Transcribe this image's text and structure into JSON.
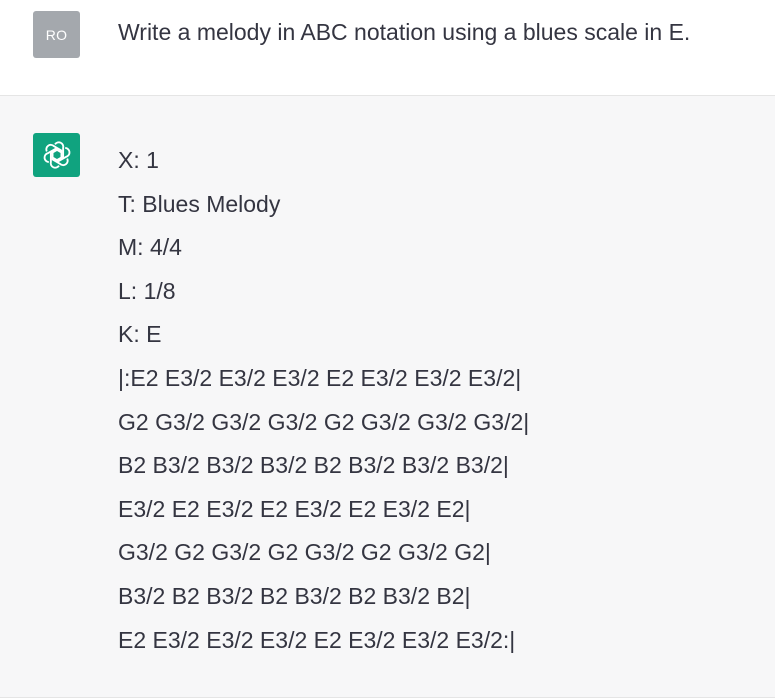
{
  "user_message": {
    "avatar_initials": "RO",
    "text": "Write a melody in ABC notation using a blues scale in E."
  },
  "assistant_message": {
    "avatar_icon": "openai-logo-icon",
    "lines": [
      "X: 1",
      "T: Blues Melody",
      "M: 4/4",
      "L: 1/8",
      "K: E",
      "|:E2 E3/2 E3/2 E3/2 E2 E3/2 E3/2 E3/2|",
      "G2 G3/2 G3/2 G3/2 G2 G3/2 G3/2 G3/2|",
      "B2 B3/2 B3/2 B3/2 B2 B3/2 B3/2 B3/2|",
      "E3/2 E2 E3/2 E2 E3/2 E2 E3/2 E2|",
      "G3/2 G2 G3/2 G2 G3/2 G2 G3/2 G2|",
      "B3/2 B2 B3/2 B2 B3/2 B2 B3/2 B2|",
      "E2 E3/2 E3/2 E3/2 E2 E3/2 E3/2 E3/2:|"
    ]
  },
  "colors": {
    "user_avatar_bg": "#a4a8ad",
    "bot_avatar_bg": "#10a37f",
    "assistant_row_bg": "#f7f7f8",
    "text": "#343541"
  }
}
